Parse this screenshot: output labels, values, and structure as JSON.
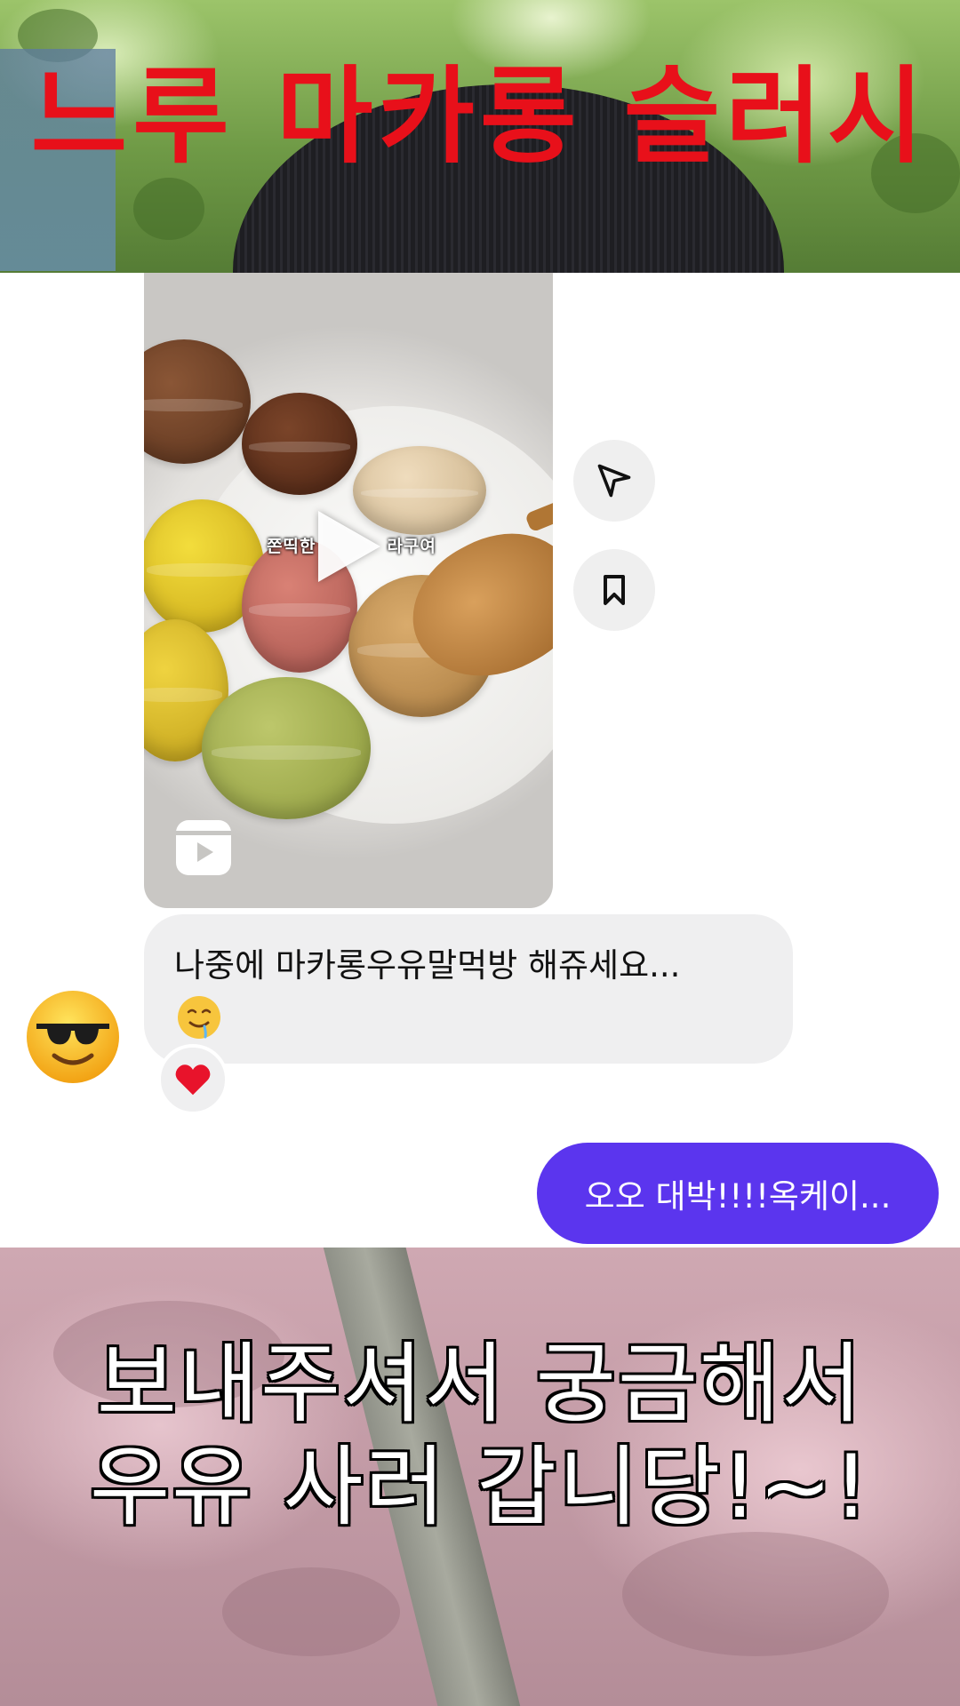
{
  "overlay": {
    "title": "느루 마카롱 슬러시",
    "caption_line1": "보내주셔서 궁금해서",
    "caption_line2": "우유 사러 갑니당!~!"
  },
  "reel": {
    "caption_left": "쫀띡한",
    "caption_right": "라구여",
    "reels_icon": "reels-icon",
    "play_icon": "play-icon"
  },
  "actions": {
    "share_icon": "paper-plane-icon",
    "save_icon": "bookmark-icon"
  },
  "messages": {
    "received_text": "나중에 마카롱우유말먹방 해쥬세요...",
    "received_emoji": "drooling-face-emoji",
    "reaction": "red-heart",
    "sender_avatar": "sunglasses-face-emoji",
    "sent_text": "오오 대박!!!!옥케이..."
  },
  "colors": {
    "title_red": "#e8101a",
    "sent_bubble": "#5b35ee",
    "received_bubble": "#efeff0"
  }
}
